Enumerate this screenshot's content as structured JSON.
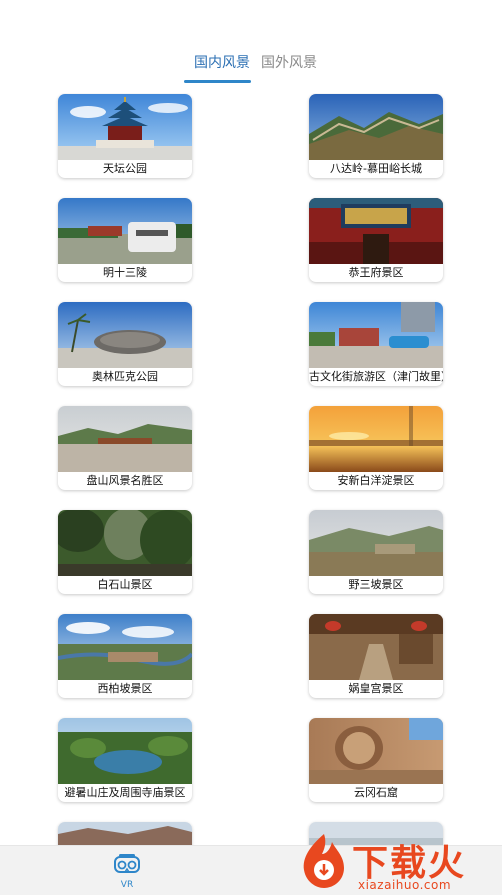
{
  "tabs": {
    "domestic": "国内风景",
    "foreign": "国外风景"
  },
  "scenes": [
    {
      "name": "天坛公园"
    },
    {
      "name": "八达岭-慕田峪长城"
    },
    {
      "name": "明十三陵"
    },
    {
      "name": "恭王府景区"
    },
    {
      "name": "奥林匹克公园"
    },
    {
      "name": "古文化街旅游区（津门故里）"
    },
    {
      "name": "盘山风景名胜区"
    },
    {
      "name": "安新白洋淀景区"
    },
    {
      "name": "白石山景区"
    },
    {
      "name": "野三坡景区"
    },
    {
      "name": "西柏坡景区"
    },
    {
      "name": "娲皇宫景区"
    },
    {
      "name": "避暑山庄及周围寺庙景区"
    },
    {
      "name": "云冈石窟"
    },
    {
      "name": ""
    },
    {
      "name": ""
    }
  ],
  "bottom_nav": {
    "vr_label": "VR"
  },
  "watermark": {
    "main": "下载火",
    "url": "xiazaihuo.com"
  },
  "colors": {
    "accent": "#2e86c9",
    "watermark": "#e8481f"
  }
}
